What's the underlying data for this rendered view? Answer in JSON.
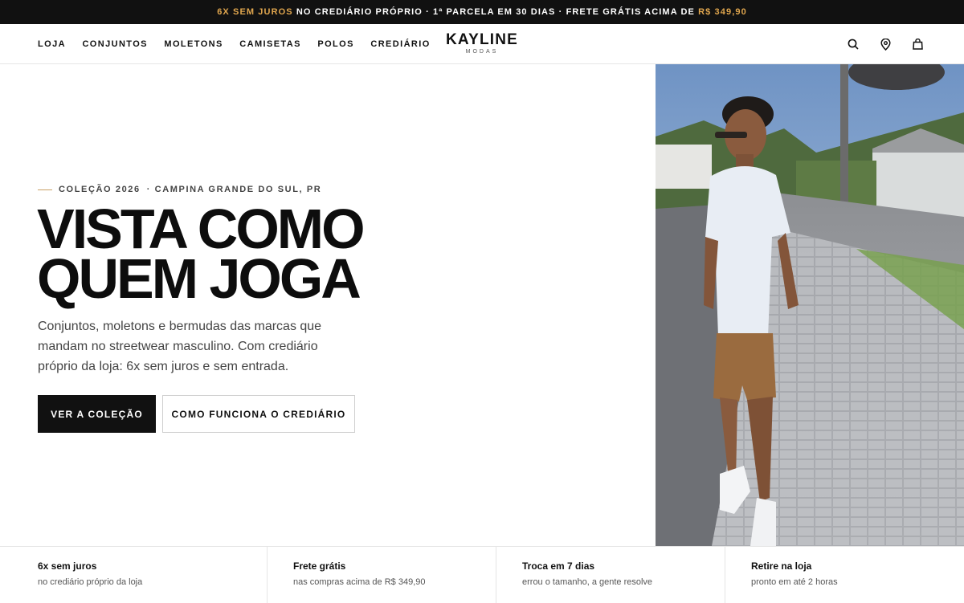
{
  "promo": {
    "part1": "6X SEM JUROS",
    "part2": " NO CREDIÁRIO PRÓPRIO · 1ª PARCELA EM 30 DIAS · FRETE GRÁTIS ACIMA DE ",
    "part3": "R$ 349,90"
  },
  "nav": [
    "LOJA",
    "CONJUNTOS",
    "MOLETONS",
    "CAMISETAS",
    "POLOS",
    "CREDIÁRIO"
  ],
  "logo": {
    "brand": "KAYLINE",
    "sub": "MODAS"
  },
  "icons": [
    "search-icon",
    "location-icon",
    "bag-icon"
  ],
  "hero": {
    "eyebrow": "COLEÇÃO 2026",
    "location": "· CAMPINA GRANDE DO SUL, PR",
    "headline1": "VISTA COMO",
    "headline2": "QUEM JOGA",
    "description": "Conjuntos, moletons e bermudas das marcas que mandam no streetwear masculino. Com crediário próprio da loja: 6x sem juros e sem entrada.",
    "primary_button": "VER A COLEÇÃO",
    "secondary_button": "COMO FUNCIONA O CREDIÁRIO"
  },
  "features": [
    {
      "title": "6x sem juros",
      "subtitle": "no crediário próprio da loja"
    },
    {
      "title": "Frete grátis",
      "subtitle": "nas compras acima de R$ 349,90"
    },
    {
      "title": "Troca em 7 dias",
      "subtitle": "errou o tamanho, a gente resolve"
    },
    {
      "title": "Retire na loja",
      "subtitle": "pronto em até 2 horas"
    }
  ],
  "colors": {
    "accent": "#e0a64e",
    "dark": "#111111"
  }
}
